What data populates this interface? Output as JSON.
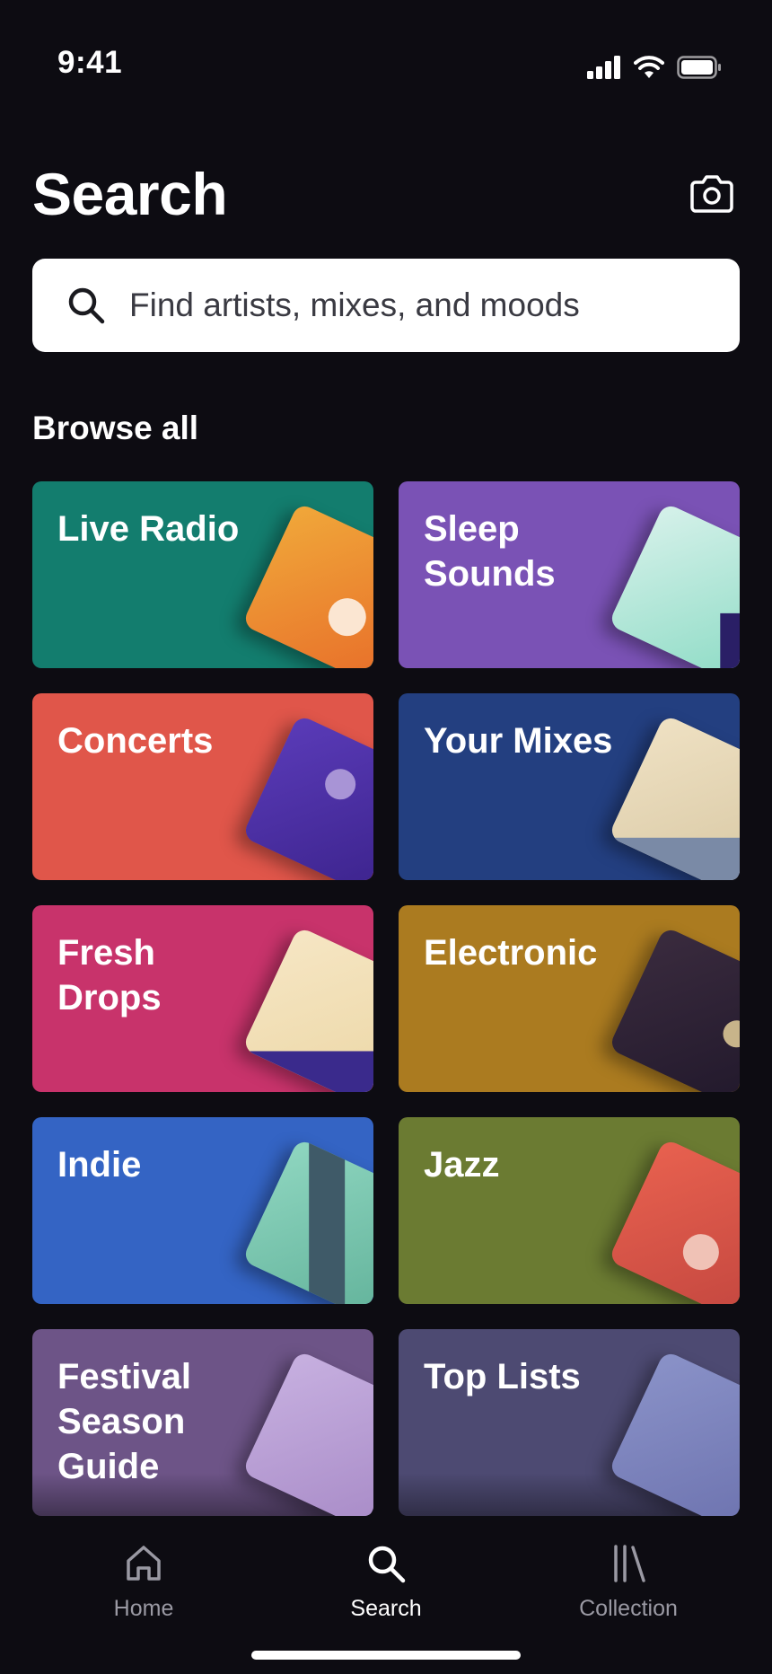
{
  "status_bar": {
    "time": "9:41"
  },
  "header": {
    "title": "Search"
  },
  "search": {
    "placeholder": "Find artists, mixes, and moods"
  },
  "browse": {
    "title": "Browse all",
    "tiles": [
      {
        "label": "Live Radio",
        "color": "#137d6e"
      },
      {
        "label": "Sleep\nSounds",
        "color": "#7a52b5"
      },
      {
        "label": "Concerts",
        "color": "#e0564a"
      },
      {
        "label": "Your Mixes",
        "color": "#233f80"
      },
      {
        "label": "Fresh\nDrops",
        "color": "#c8336b"
      },
      {
        "label": "Electronic",
        "color": "#ab7b20"
      },
      {
        "label": "Indie",
        "color": "#3464c4"
      },
      {
        "label": "Jazz",
        "color": "#6b7b32"
      },
      {
        "label": "Festival\nSeason\nGuide",
        "color": "#6d5487"
      },
      {
        "label": "Top Lists",
        "color": "#4d4a72"
      }
    ]
  },
  "tabbar": {
    "tabs": [
      {
        "label": "Home",
        "icon": "home-icon",
        "active": false
      },
      {
        "label": "Search",
        "icon": "search-icon",
        "active": true
      },
      {
        "label": "Collection",
        "icon": "collection-icon",
        "active": false
      }
    ]
  }
}
